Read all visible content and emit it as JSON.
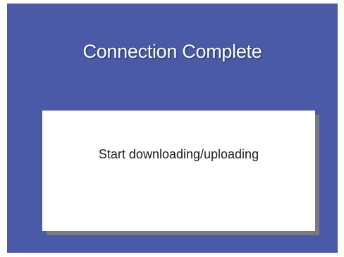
{
  "screen": {
    "title": "Connection Complete",
    "background_color": "#4a5aa7"
  },
  "card": {
    "label": "Start downloading/uploading"
  }
}
